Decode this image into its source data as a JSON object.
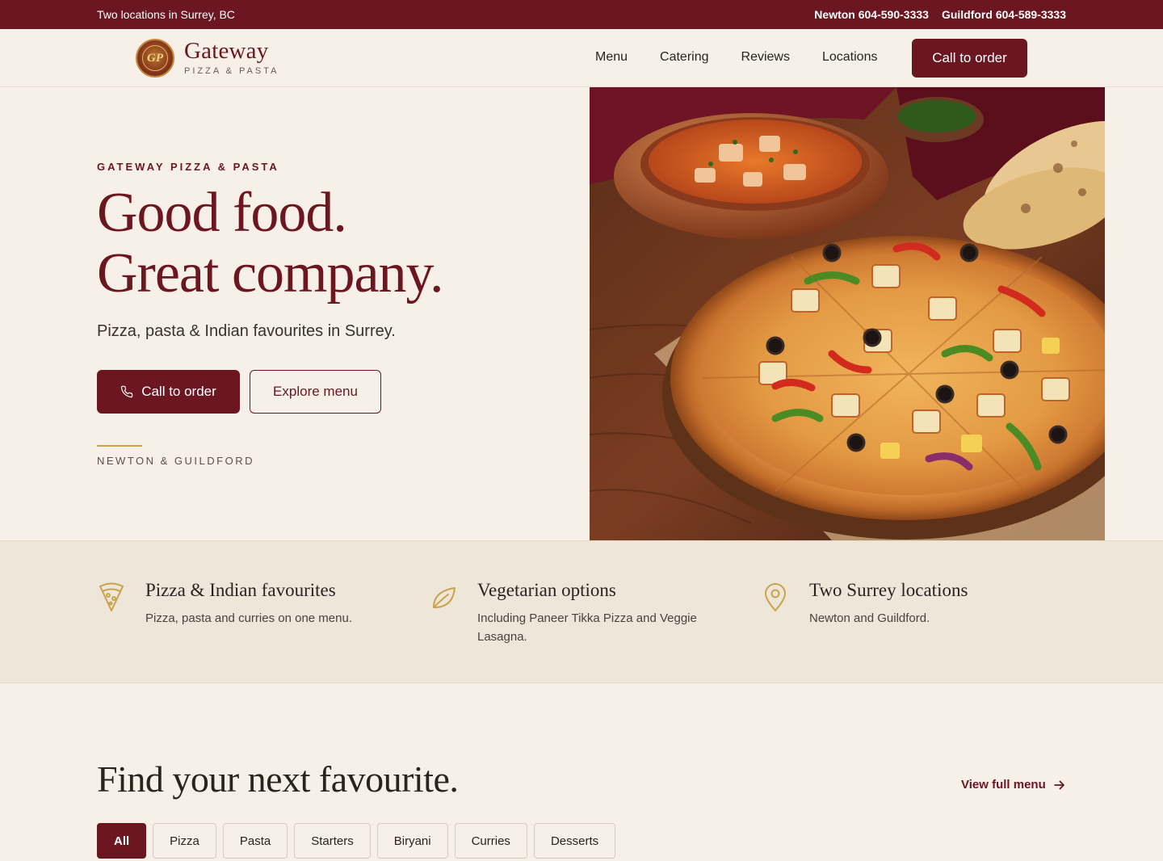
{
  "topbar": {
    "tagline": "Two locations in Surrey, BC",
    "phones": [
      {
        "label": "Newton 604-590-3333"
      },
      {
        "label": "Guildford 604-589-3333"
      }
    ]
  },
  "header": {
    "logo_monogram": "GP",
    "brand_name": "Gateway",
    "brand_sub": "PIZZA & PASTA",
    "nav": [
      "Menu",
      "Catering",
      "Reviews",
      "Locations"
    ],
    "cta": "Call to order"
  },
  "hero": {
    "eyebrow": "GATEWAY PIZZA & PASTA",
    "title_line1": "Good food.",
    "title_line2": "Great company.",
    "subtitle": "Pizza, pasta & Indian favourites in Surrey.",
    "primary_button": "Call to order",
    "secondary_button": "Explore menu",
    "locations_tag": "NEWTON & GUILDFORD"
  },
  "features": [
    {
      "icon": "pizza-slice-icon",
      "title": "Pizza & Indian favourites",
      "desc": "Pizza, pasta and curries on one menu."
    },
    {
      "icon": "leaf-icon",
      "title": "Vegetarian options",
      "desc": "Including Paneer Tikka Pizza and Veggie Lasagna."
    },
    {
      "icon": "map-pin-icon",
      "title": "Two Surrey locations",
      "desc": "Newton and Guildford."
    }
  ],
  "menu_section": {
    "title": "Find your next favourite.",
    "view_link": "View full menu",
    "tabs": [
      "All",
      "Pizza",
      "Pasta",
      "Starters",
      "Biryani",
      "Curries",
      "Desserts"
    ],
    "active_tab": "All"
  },
  "colors": {
    "brand": "#6b1620",
    "accent_gold": "#c9a24a",
    "background": "#f7f0e8",
    "band": "#efe6da"
  }
}
